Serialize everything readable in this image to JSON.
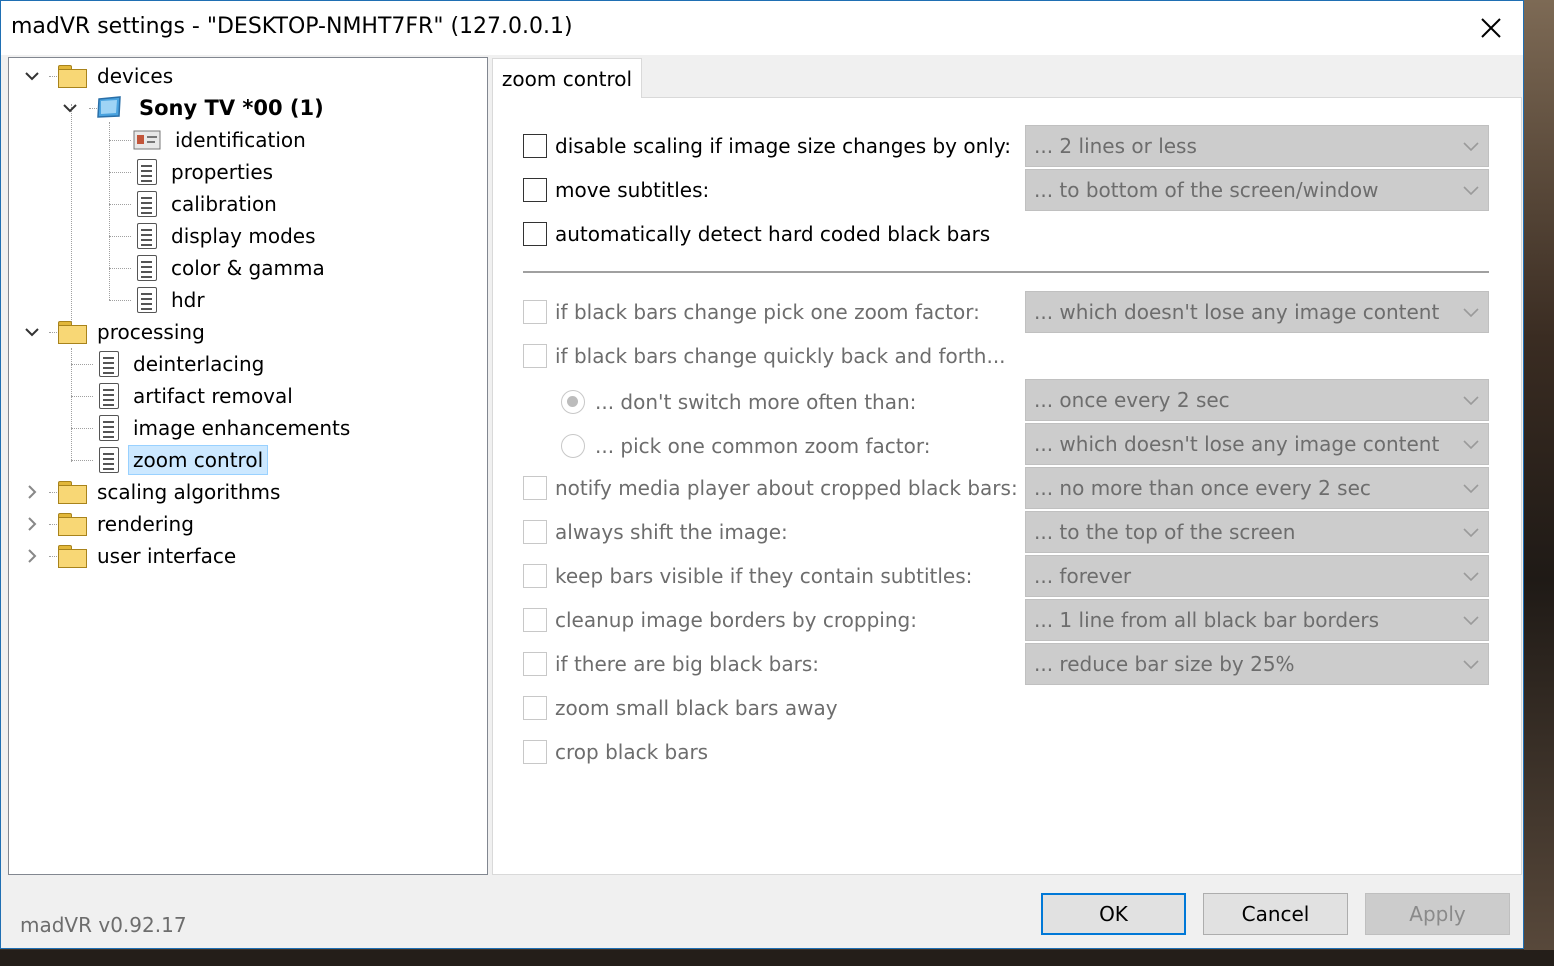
{
  "window": {
    "title": "madVR settings - \"DESKTOP-NMHT7FR\" (127.0.0.1)",
    "close_glyph": "✕"
  },
  "tree": {
    "devices": "devices",
    "device_name": "Sony TV *00 (1)",
    "identification": "identification",
    "properties": "properties",
    "calibration": "calibration",
    "display_modes": "display modes",
    "color_gamma": "color & gamma",
    "hdr": "hdr",
    "processing": "processing",
    "deinterlacing": "deinterlacing",
    "artifact_removal": "artifact removal",
    "image_enhancements": "image enhancements",
    "zoom_control": "zoom control",
    "scaling_algorithms": "scaling algorithms",
    "rendering": "rendering",
    "user_interface": "user interface"
  },
  "tab": {
    "label": "zoom control"
  },
  "options": {
    "disable_scaling": "disable scaling if image size changes by only:",
    "move_subtitles": "move subtitles:",
    "auto_detect": "automatically detect hard coded black bars",
    "pick_zoom": "if black bars change pick one zoom factor:",
    "change_quickly": "if black bars change quickly back and forth...",
    "dont_switch": "... don't switch more often than:",
    "pick_common": "... pick one common zoom factor:",
    "notify_player": "notify media player about cropped black bars:",
    "always_shift": "always shift the image:",
    "keep_bars": "keep bars visible if they contain subtitles:",
    "cleanup_borders": "cleanup image borders by cropping:",
    "big_bars": "if there are big black bars:",
    "zoom_small": "zoom small black bars away",
    "crop_bars": "crop black bars"
  },
  "dropdowns": {
    "disable_scaling": "... 2 lines or less",
    "move_subtitles": "... to bottom of the screen/window",
    "pick_zoom": "... which doesn't lose any image content",
    "dont_switch": "... once every 2 sec",
    "pick_common": "... which doesn't lose any image content",
    "notify_player": "... no more than once every 2 sec",
    "always_shift": "... to the top of the screen",
    "keep_bars": "... forever",
    "cleanup_borders": "... 1 line from all black bar borders",
    "big_bars": "... reduce bar size by 25%"
  },
  "footer": {
    "version": "madVR v0.92.17",
    "ok": "OK",
    "cancel": "Cancel",
    "apply": "Apply"
  },
  "colors": {
    "selection": "#cce8ff",
    "accent": "#0078d7",
    "disabled_text": "#6d6d6d"
  }
}
